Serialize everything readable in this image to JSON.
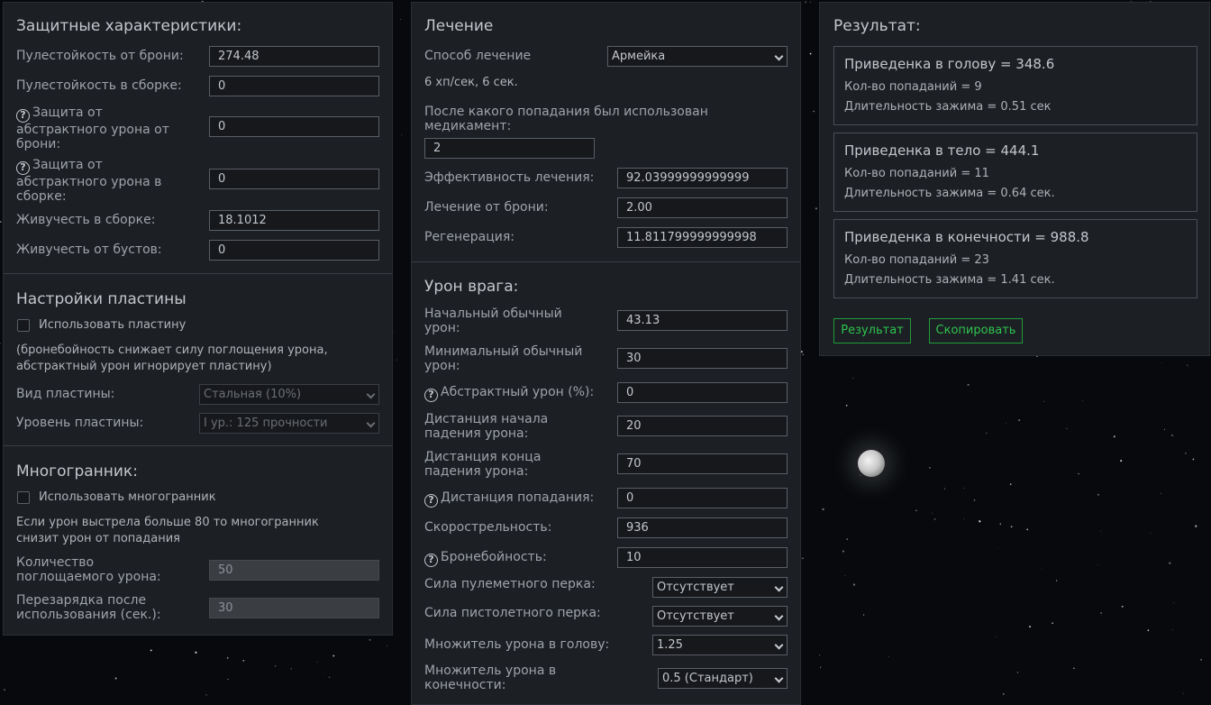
{
  "defense": {
    "title": "Защитные характеристики:",
    "armor_bullet_resist": {
      "label": "Пулестойкость от брони:",
      "value": "274.48"
    },
    "build_bullet_resist": {
      "label": "Пулестойкость в сборке:",
      "value": "0"
    },
    "armor_abstract_protect": {
      "label_l1": "Защита от",
      "label_l2": "абстрактного урона от",
      "label_l3": "брони:",
      "value": "0"
    },
    "build_abstract_protect": {
      "label_l1": "Защита от",
      "label_l2": "абстрактного урона в",
      "label_l3": "сборке:",
      "value": "0"
    },
    "build_vitality": {
      "label": "Живучесть в сборке:",
      "value": "18.1012"
    },
    "boost_vitality": {
      "label": "Живучесть от бустов:",
      "value": "0"
    }
  },
  "plate": {
    "title": "Настройки пластины",
    "use_label": "Использовать пластину",
    "note_l1": "(бронебойность снижает силу поглощения урона,",
    "note_l2": "абстрактный урон игнорирует пластину)",
    "type": {
      "label": "Вид пластины:",
      "value": "Стальная (10%)"
    },
    "level": {
      "label": "Уровень пластины:",
      "value": "I ур.: 125 прочности"
    }
  },
  "polyhedron": {
    "title": "Многогранник:",
    "use_label": "Использовать многогранник",
    "note_l1": "Если урон выстрела больше 80 то многогранник",
    "note_l2": "снизит урон от попадания",
    "absorb": {
      "label_l1": "Количество",
      "label_l2": "поглощаемого урона:",
      "value": "50"
    },
    "cooldown": {
      "label_l1": "Перезарядка после",
      "label_l2": "использования (сек.):",
      "value": "30"
    }
  },
  "healing": {
    "title": "Лечение",
    "method": {
      "label": "Способ лечение",
      "value": "Армейка"
    },
    "rate_text": "6 хп/сек, 6 сек.",
    "after_hit": {
      "label_l1": "После какого попадания был использован",
      "label_l2": "медикамент:",
      "value": "2"
    },
    "efficiency": {
      "label": "Эффективность лечения:",
      "value": "92.03999999999999"
    },
    "armor_heal": {
      "label": "Лечение от брони:",
      "value": "2.00"
    },
    "regen": {
      "label": "Регенерация:",
      "value": "11.811799999999998"
    }
  },
  "enemy": {
    "title": "Урон врага:",
    "base_damage": {
      "label_l1": "Начальный обычный",
      "label_l2": "урон:",
      "value": "43.13"
    },
    "min_damage": {
      "label_l1": "Минимальный обычный",
      "label_l2": "урон:",
      "value": "30"
    },
    "abstract_pct": {
      "label": "Абстрактный урон (%):",
      "value": "0"
    },
    "falloff_start": {
      "label_l1": "Дистанция начала",
      "label_l2": "падения урона:",
      "value": "20"
    },
    "falloff_end": {
      "label_l1": "Дистанция конца",
      "label_l2": "падения урона:",
      "value": "70"
    },
    "hit_distance": {
      "label": "Дистанция попадания:",
      "value": "0"
    },
    "fire_rate": {
      "label": "Скорострельность:",
      "value": "936"
    },
    "penetration": {
      "label": "Бронебойность:",
      "value": "10"
    },
    "mg_perk": {
      "label": "Сила пулеметного перка:",
      "value": "Отсутствует"
    },
    "pistol_perk": {
      "label": "Сила пистолетного перка:",
      "value": "Отсутствует"
    },
    "head_mult": {
      "label": "Множитель урона в голову:",
      "value": "1.25"
    },
    "limb_mult": {
      "label_l1": "Множитель урона в",
      "label_l2": "конечности:",
      "value": "0.5 (Стандарт)"
    }
  },
  "result": {
    "title": "Результат:",
    "head": {
      "title": "Приведенка в голову = 348.6",
      "hits": "Кол-во попаданий = 9",
      "hold": "Длительность зажима = 0.51 сек"
    },
    "body": {
      "title": "Приведенка в тело = 444.1",
      "hits": "Кол-во попаданий = 11",
      "hold": "Длительность зажима = 0.64 сек."
    },
    "limbs": {
      "title": "Приведенка в конечности = 988.8",
      "hits": "Кол-во попаданий = 23",
      "hold": "Длительность зажима = 1.41 сек."
    },
    "result_button": "Результат",
    "copy_button": "Скопировать"
  },
  "icons": {
    "help": "?"
  },
  "colors": {
    "panel": "#1c1f24",
    "accent_green": "#2ec44d",
    "background": "#07090c"
  }
}
